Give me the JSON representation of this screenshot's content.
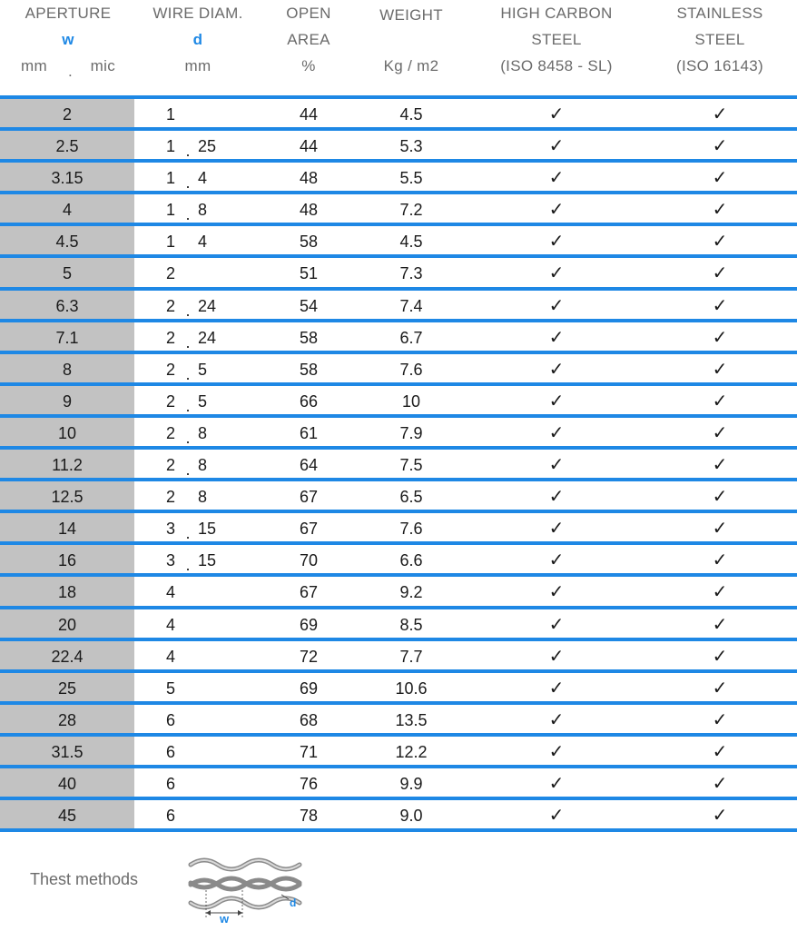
{
  "header": {
    "aperture": {
      "line1": "APERTURE",
      "symbol": "w",
      "unit_left": "mm",
      "unit_dot": ".",
      "unit_right": "mic"
    },
    "wire_diam": {
      "line1": "WIRE DIAM.",
      "symbol": "d",
      "unit": "mm"
    },
    "open_area": {
      "line1": "OPEN",
      "line2": "AREA",
      "unit": "%"
    },
    "weight": {
      "line1": "WEIGHT",
      "unit": "Kg / m2"
    },
    "high_carbon": {
      "line1": "HIGH CARBON",
      "line2": "STEEL",
      "line3": "(ISO 8458 - SL)"
    },
    "stainless": {
      "line1": "STAINLESS",
      "line2": "STEEL",
      "line3": "(ISO 16143)"
    }
  },
  "check_glyph": "✓",
  "rows": [
    {
      "aperture": "2",
      "wd_int": "1",
      "wd_sep": "",
      "wd_frac": "",
      "open_area": "44",
      "weight": "4.5"
    },
    {
      "aperture": "2.5",
      "wd_int": "1",
      "wd_sep": ".",
      "wd_frac": "25",
      "open_area": "44",
      "weight": "5.3"
    },
    {
      "aperture": "3.15",
      "wd_int": "1",
      "wd_sep": ".",
      "wd_frac": "4",
      "open_area": "48",
      "weight": "5.5"
    },
    {
      "aperture": "4",
      "wd_int": "1",
      "wd_sep": ".",
      "wd_frac": "8",
      "open_area": "48",
      "weight": "7.2"
    },
    {
      "aperture": "4.5",
      "wd_int": "1",
      "wd_sep": "",
      "wd_frac": "4",
      "open_area": "58",
      "weight": "4.5"
    },
    {
      "aperture": "5",
      "wd_int": "2",
      "wd_sep": "",
      "wd_frac": "",
      "open_area": "51",
      "weight": "7.3"
    },
    {
      "aperture": "6.3",
      "wd_int": "2",
      "wd_sep": ".",
      "wd_frac": "24",
      "open_area": "54",
      "weight": "7.4"
    },
    {
      "aperture": "7.1",
      "wd_int": "2",
      "wd_sep": ".",
      "wd_frac": "24",
      "open_area": "58",
      "weight": "6.7"
    },
    {
      "aperture": "8",
      "wd_int": "2",
      "wd_sep": ".",
      "wd_frac": "5",
      "open_area": "58",
      "weight": "7.6"
    },
    {
      "aperture": "9",
      "wd_int": "2",
      "wd_sep": ".",
      "wd_frac": "5",
      "open_area": "66",
      "weight": "10"
    },
    {
      "aperture": "10",
      "wd_int": "2",
      "wd_sep": ".",
      "wd_frac": "8",
      "open_area": "61",
      "weight": "7.9"
    },
    {
      "aperture": "11.2",
      "wd_int": "2",
      "wd_sep": ".",
      "wd_frac": "8",
      "open_area": "64",
      "weight": "7.5"
    },
    {
      "aperture": "12.5",
      "wd_int": "2",
      "wd_sep": "",
      "wd_frac": "8",
      "open_area": "67",
      "weight": "6.5"
    },
    {
      "aperture": "14",
      "wd_int": "3",
      "wd_sep": ".",
      "wd_frac": "15",
      "open_area": "67",
      "weight": "7.6"
    },
    {
      "aperture": "16",
      "wd_int": "3",
      "wd_sep": ".",
      "wd_frac": "15",
      "open_area": "70",
      "weight": "6.6"
    },
    {
      "aperture": "18",
      "wd_int": "4",
      "wd_sep": "",
      "wd_frac": "",
      "open_area": "67",
      "weight": "9.2"
    },
    {
      "aperture": "20",
      "wd_int": "4",
      "wd_sep": "",
      "wd_frac": "",
      "open_area": "69",
      "weight": "8.5"
    },
    {
      "aperture": "22.4",
      "wd_int": "4",
      "wd_sep": "",
      "wd_frac": "",
      "open_area": "72",
      "weight": "7.7"
    },
    {
      "aperture": "25",
      "wd_int": "5",
      "wd_sep": "",
      "wd_frac": "",
      "open_area": "69",
      "weight": "10.6"
    },
    {
      "aperture": "28",
      "wd_int": "6",
      "wd_sep": "",
      "wd_frac": "",
      "open_area": "68",
      "weight": "13.5"
    },
    {
      "aperture": "31.5",
      "wd_int": "6",
      "wd_sep": "",
      "wd_frac": "",
      "open_area": "71",
      "weight": "12.2"
    },
    {
      "aperture": "40",
      "wd_int": "6",
      "wd_sep": "",
      "wd_frac": "",
      "open_area": "76",
      "weight": "9.9"
    },
    {
      "aperture": "45",
      "wd_int": "6",
      "wd_sep": "",
      "wd_frac": "",
      "open_area": "78",
      "weight": "9.0"
    }
  ],
  "footer": {
    "label": "Thest methods",
    "diagram_w": "w",
    "diagram_d": "d"
  },
  "colors": {
    "accent": "#1e88e5",
    "aperture_bg": "#c2c2c2",
    "header_text": "#6b6b6b"
  }
}
